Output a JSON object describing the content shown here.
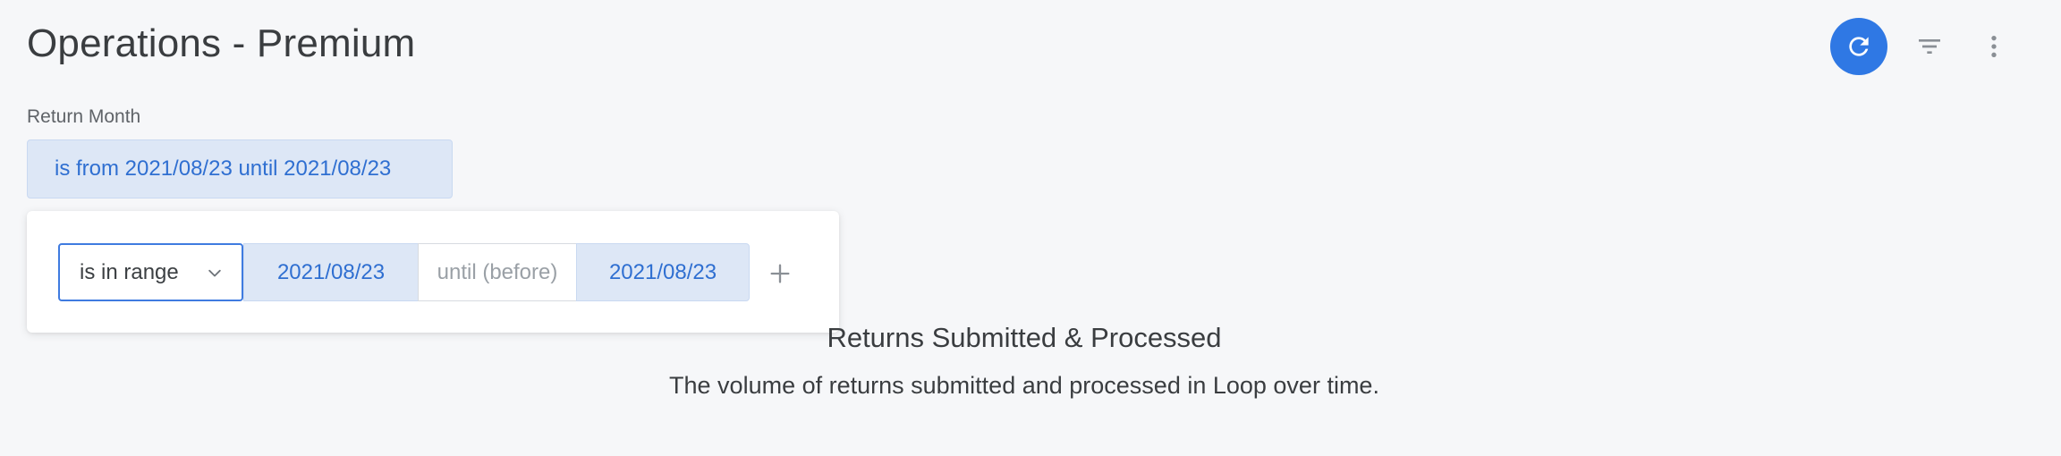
{
  "header": {
    "title": "Operations - Premium",
    "icons": {
      "refresh": "refresh-icon",
      "filter": "filter-icon",
      "more": "more-vert-icon"
    }
  },
  "filter": {
    "label": "Return Month",
    "chip_text": "is from 2021/08/23 until 2021/08/23",
    "popover": {
      "operator": "is in range",
      "start_date": "2021/08/23",
      "until_label": "until (before)",
      "end_date": "2021/08/23",
      "add_icon": "plus-icon"
    }
  },
  "tile": {
    "title": "Returns Submitted & Processed",
    "subtitle": "The volume of returns submitted and processed in Loop over time."
  },
  "colors": {
    "accent": "#2f78e4",
    "chip_bg": "#dde7f6",
    "chip_text": "#2f6fd1",
    "background": "#f6f7f9"
  }
}
